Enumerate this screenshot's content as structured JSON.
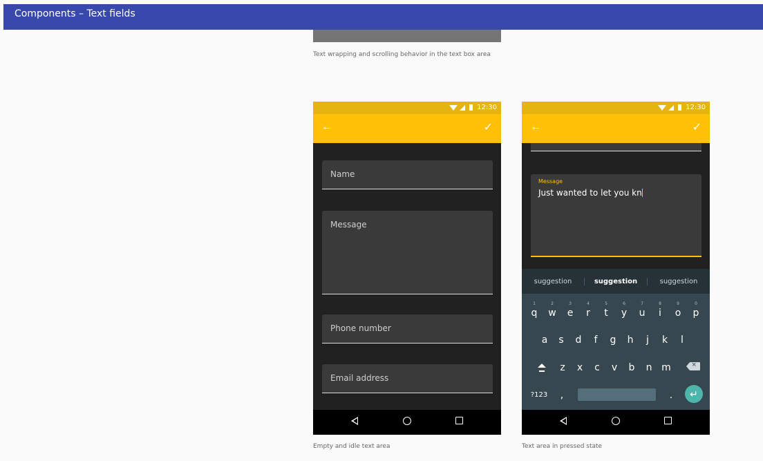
{
  "header": {
    "title": "Components  –  Text fields"
  },
  "captions": {
    "top": "Text wrapping and scrolling behavior in the text box area",
    "left_phone": "Empty and idle text area",
    "right_phone": "Text area in pressed state"
  },
  "status_bar": {
    "time": "12:30"
  },
  "colors": {
    "app_bar": "#ffc107",
    "status_bar": "#e6b411",
    "page_header": "#3949ab",
    "keyboard": "#37474f",
    "enter_key": "#4db6ac"
  },
  "left_phone": {
    "fields": [
      {
        "placeholder": "Name"
      },
      {
        "placeholder": "Message"
      },
      {
        "placeholder": "Phone number"
      },
      {
        "placeholder": "Email address"
      }
    ]
  },
  "right_phone": {
    "message": {
      "label": "Message",
      "value": "Just wanted to let you kn"
    },
    "suggestions": [
      "suggestion",
      "suggestion",
      "suggestion"
    ],
    "keyboard": {
      "row1": [
        {
          "key": "q",
          "num": "1"
        },
        {
          "key": "w",
          "num": "2"
        },
        {
          "key": "e",
          "num": "3"
        },
        {
          "key": "r",
          "num": "4"
        },
        {
          "key": "t",
          "num": "5"
        },
        {
          "key": "y",
          "num": "6"
        },
        {
          "key": "u",
          "num": "7"
        },
        {
          "key": "i",
          "num": "8"
        },
        {
          "key": "o",
          "num": "9"
        },
        {
          "key": "p",
          "num": "0"
        }
      ],
      "row2": [
        "a",
        "s",
        "d",
        "f",
        "g",
        "h",
        "j",
        "k",
        "l"
      ],
      "row3": [
        "z",
        "x",
        "c",
        "v",
        "b",
        "n",
        "m"
      ],
      "symbols_key": "?123",
      "comma_key": ",",
      "period_key": "."
    }
  },
  "icons": {
    "back": "arrow-back-icon",
    "done": "check-icon",
    "nav_back": "nav-back-triangle-icon",
    "nav_home": "nav-home-circle-icon",
    "nav_recent": "nav-recent-square-icon"
  }
}
